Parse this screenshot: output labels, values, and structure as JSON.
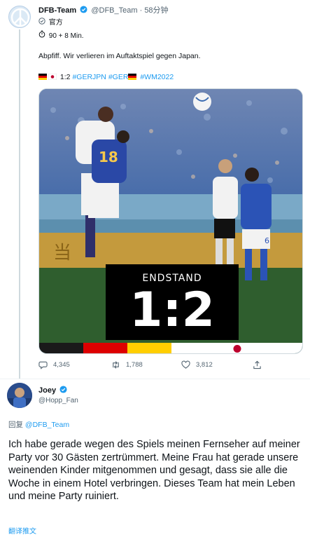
{
  "tweet": {
    "author_name": "DFB-Team",
    "author_handle": "@DFB_Team",
    "separator": "·",
    "time": "58分钟",
    "label": "官方",
    "match_time": "90 + 8 Min.",
    "text": "Abpfiff. Wir verlieren im Auftaktspiel gegen Japan.",
    "score": "1:2",
    "hashtags": [
      "#GERJPN",
      "#GER",
      "#WM2022"
    ],
    "media": {
      "label": "ENDSTAND",
      "score": "1:2"
    },
    "actions": {
      "replies": "4,345",
      "retweets": "1,788",
      "likes": "3,812"
    }
  },
  "reply": {
    "author_name": "Joey",
    "author_handle": "@Hopp_Fan",
    "reply_prefix": "回复",
    "reply_to": "@DFB_Team",
    "text": "Ich habe gerade wegen des Spiels meinen Fernseher auf meiner Party vor 30 Gästen zertrümmert. Meine Frau hat gerade unsere weinenden Kinder mitgenommen und gesagt, dass sie alle die Woche in einem Hotel verbringen. Dieses Team hat mein Leben und meine Party ruiniert.",
    "translate": "翻译推文"
  },
  "colors": {
    "link": "#1d9bf0",
    "text": "#0f1419",
    "secondary": "#536471",
    "germany_black": "#000000",
    "germany_red": "#dd0000",
    "germany_gold": "#ffce00",
    "japan_red": "#bc002d"
  },
  "icons": [
    "peace-icon",
    "verified-icon",
    "official-badge-icon",
    "stopwatch-icon",
    "reply-icon",
    "retweet-icon",
    "like-icon",
    "share-icon",
    "german-flag-icon",
    "japanese-flag-icon"
  ]
}
